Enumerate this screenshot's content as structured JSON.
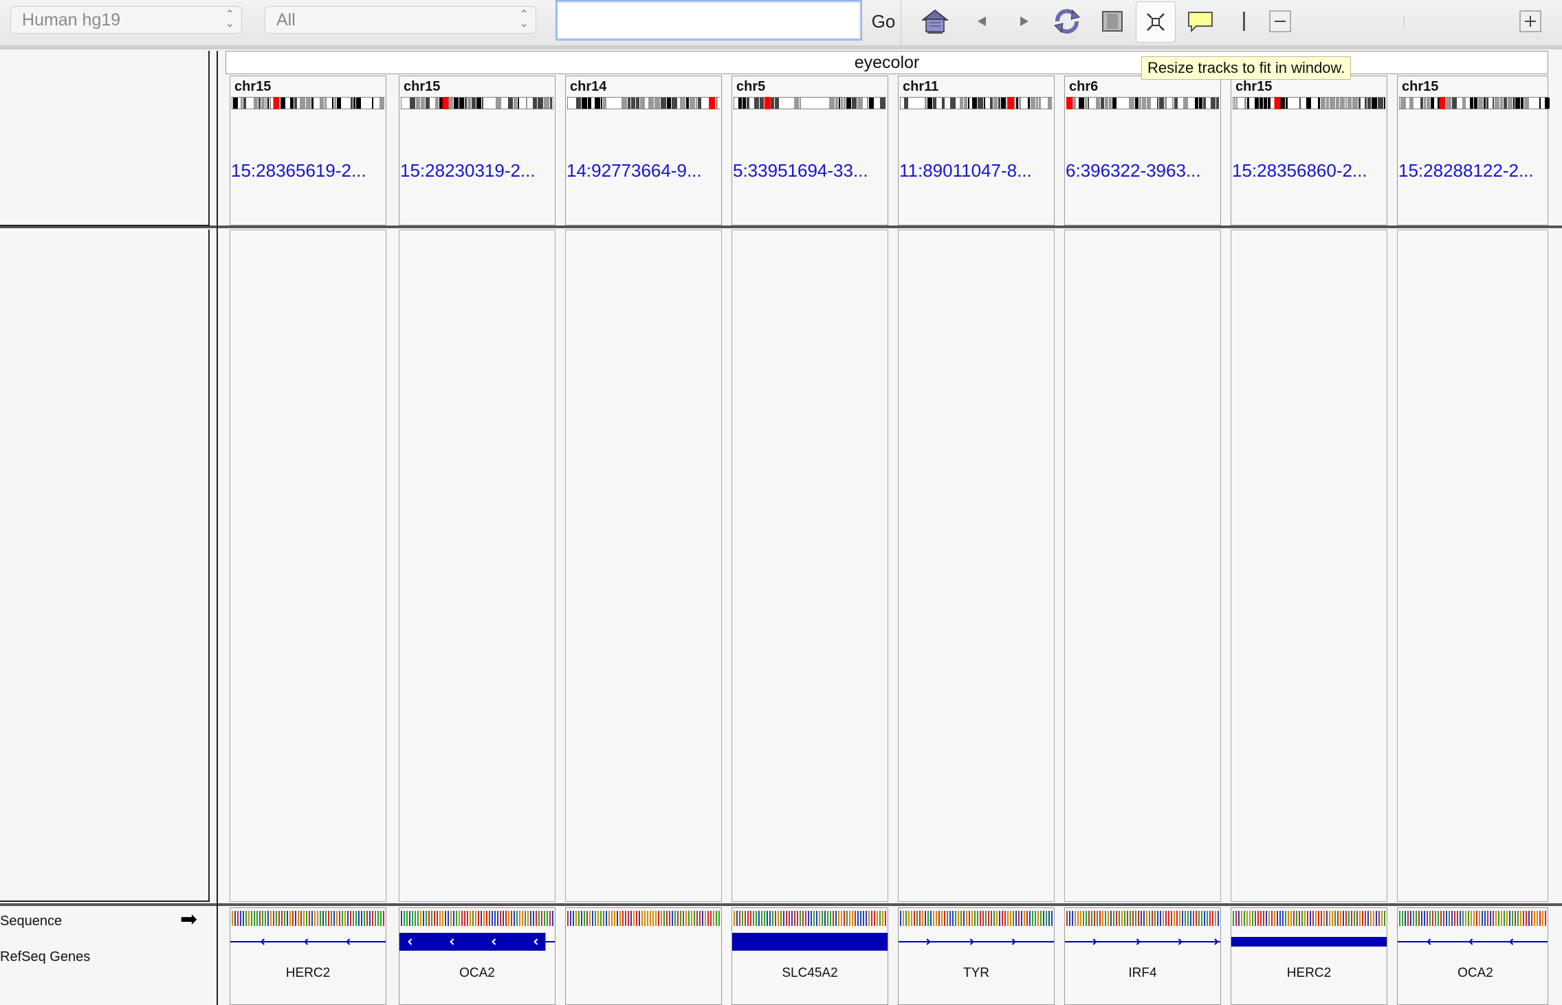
{
  "toolbar": {
    "genome": "Human hg19",
    "chromosome": "All",
    "locus_value": "",
    "go_label": "Go"
  },
  "tooltip": "Resize tracks to fit in window.",
  "group_name": "eyecolor",
  "track_names": {
    "sequence": "Sequence",
    "genes": "RefSeq Genes"
  },
  "panels": [
    {
      "chr": "chr15",
      "locus": "15:28365619-2...",
      "gene": "HERC2",
      "strand": "minus",
      "style": "line",
      "band_pos": 0.27
    },
    {
      "chr": "chr15",
      "locus": "15:28230319-2...",
      "gene": "OCA2",
      "strand": "minus",
      "style": "partial",
      "band_pos": 0.27
    },
    {
      "chr": "chr14",
      "locus": "14:92773664-9...",
      "gene": "",
      "strand": "none",
      "style": "none",
      "band_pos": 0.92
    },
    {
      "chr": "chr5",
      "locus": "5:33951694-33...",
      "gene": "SLC45A2",
      "strand": "none",
      "style": "full",
      "band_pos": 0.2
    },
    {
      "chr": "chr11",
      "locus": "11:89011047-8...",
      "gene": "TYR",
      "strand": "plus",
      "style": "line",
      "band_pos": 0.7
    },
    {
      "chr": "chr6",
      "locus": "6:396322-3963...",
      "gene": "IRF4",
      "strand": "plus",
      "style": "thickline",
      "band_pos": 0.0
    },
    {
      "chr": "chr15",
      "locus": "15:28356860-2...",
      "gene": "HERC2",
      "strand": "none",
      "style": "thin",
      "band_pos": 0.27
    },
    {
      "chr": "chr15",
      "locus": "15:28288122-2...",
      "gene": "OCA2",
      "strand": "minus",
      "style": "line",
      "band_pos": 0.27
    }
  ],
  "colors": {
    "link": "#1515d8",
    "gene": "#0000b4",
    "band_marker": "#ff0000"
  }
}
